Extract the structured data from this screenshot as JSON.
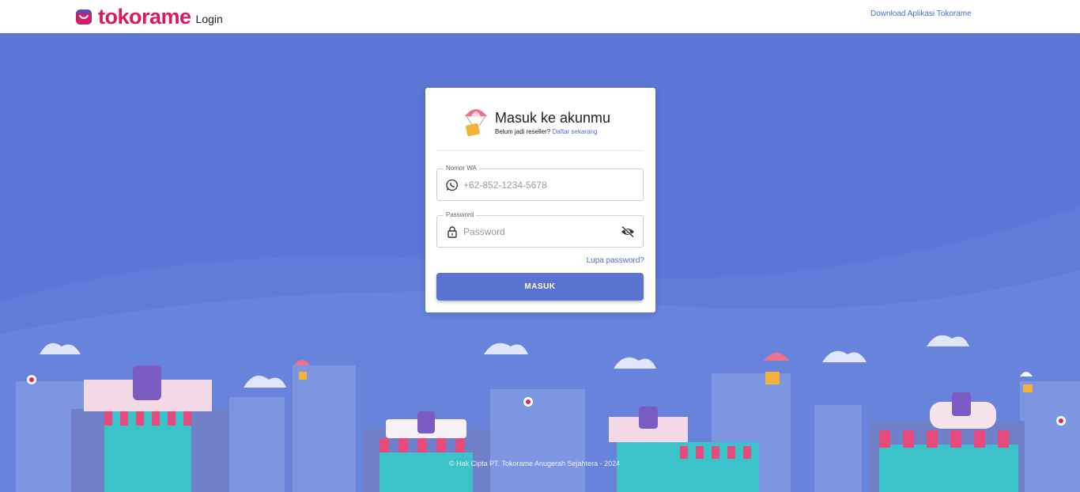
{
  "header": {
    "brand_name": "tokorame",
    "brand_sub": "Login",
    "download_link": "Download Aplikasi Tokorame"
  },
  "login": {
    "title": "Masuk ke akunmu",
    "subtitle_prefix": "Belum jadi reseller?",
    "register_link": "Daftar sekarang",
    "phone_label": "Nomor WA",
    "phone_placeholder": "+62-852-1234-5678",
    "phone_value": "",
    "password_label": "Password",
    "password_placeholder": "Password",
    "password_value": "",
    "forgot_link": "Lupa password?",
    "submit_label": "MASUK"
  },
  "footer": {
    "copyright": "© Hak Cipta PT. Tokorame Anugerah Sejahtera - 2024"
  },
  "colors": {
    "brand": "#d81b60",
    "primary": "#5a73d0",
    "link": "#4a6fcf",
    "background": "#5b76d4"
  },
  "icons": {
    "brand": "shopping-bag-icon",
    "header": "parachute-package-icon",
    "phone": "whatsapp-icon",
    "password": "lock-icon",
    "visibility": "eye-off-icon"
  }
}
